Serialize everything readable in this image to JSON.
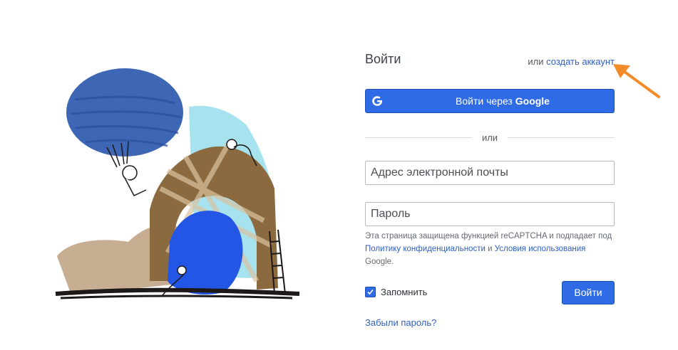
{
  "login": {
    "title": "Войти",
    "create_prefix": "или",
    "create_link": "создать аккаунт",
    "google_prefix": "Войти через",
    "google_brand": "Google",
    "or_label": "или",
    "email_placeholder": "Адрес электронной почты",
    "password_placeholder": "Пароль",
    "recaptcha": {
      "text1": "Эта страница защищена функцией reCAPTCHA и подпадает под",
      "privacy_link": "Политику конфиденциальности",
      "and": "и",
      "terms_link": "Условия использования",
      "suffix": "Google."
    },
    "remember_label": "Запомнить",
    "remember_checked": true,
    "submit_label": "Войти",
    "forgot_link": "Забыли пароль?"
  },
  "colors": {
    "primary": "#2f6be5",
    "link": "#2f5fc2",
    "annotation_arrow": "#f28c28"
  },
  "icons": {
    "google": "google-g-icon",
    "checkbox": "checkmark-icon",
    "arrow": "annotation-arrow"
  }
}
